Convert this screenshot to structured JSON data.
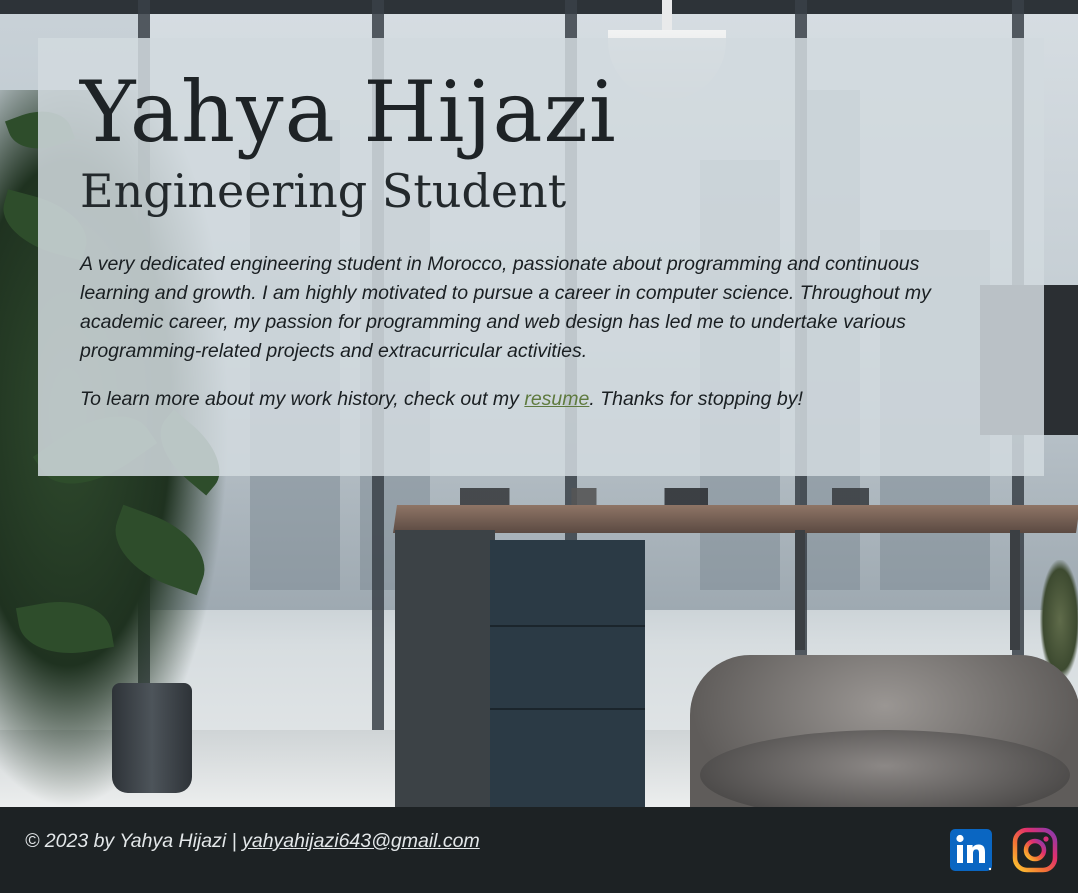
{
  "hero": {
    "name": "Yahya Hijazi",
    "title": "Engineering Student",
    "bio": "A very dedicated engineering student in Morocco, passionate about programming and continuous learning and growth. I am highly motivated to pursue a career in computer science. Throughout my academic career, my passion for programming and web design has led me to undertake various programming-related projects and extracurricular activities.",
    "cta_before": "To learn more about my work history, check out my ",
    "cta_link": "resume",
    "cta_after": ". Thanks for stopping by!"
  },
  "footer": {
    "copyright": "© 2023 by Yahya Hijazi | ",
    "email": "yahyahijazi643@gmail.com",
    "social": [
      {
        "name": "LinkedIn",
        "icon": "linkedin-icon"
      },
      {
        "name": "Instagram",
        "icon": "instagram-icon"
      }
    ]
  },
  "colors": {
    "link": "#5f7a3f",
    "footer_bg": "#1d2224",
    "linkedin": "#0a66c2"
  }
}
